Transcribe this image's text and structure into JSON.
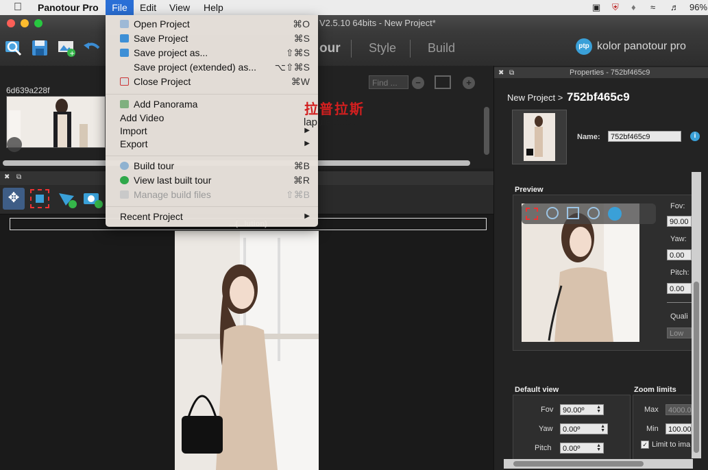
{
  "menubar": {
    "apple": "",
    "app_name": "Panotour Pro",
    "items": [
      "File",
      "Edit",
      "View",
      "Help"
    ],
    "battery": "96%"
  },
  "window": {
    "title": "V2.5.10 64bits - New Project*",
    "tabs": [
      "our",
      "Style",
      "Build"
    ],
    "brand": "kolor panotour pro",
    "brand_badge": "ptp"
  },
  "file_menu": {
    "items": [
      {
        "label": "Open Project",
        "shortcut": "⌘O",
        "icon": "open-icon"
      },
      {
        "label": "Save Project",
        "shortcut": "⌘S",
        "icon": "save-icon"
      },
      {
        "label": "Save project as...",
        "shortcut": "⇧⌘S",
        "icon": "save-as-icon"
      },
      {
        "label": "Save project (extended) as...",
        "shortcut": "⌥⇧⌘S",
        "icon": ""
      },
      {
        "label": "Close Project",
        "shortcut": "⌘W",
        "icon": "close-project-icon"
      },
      {
        "label": "Add Panorama",
        "shortcut": "",
        "icon": "add-panorama-icon"
      },
      {
        "label": "Add Video",
        "shortcut": "",
        "icon": ""
      },
      {
        "label": "Import",
        "shortcut": "",
        "icon": ""
      },
      {
        "label": "Export",
        "shortcut": "",
        "icon": ""
      },
      {
        "label": "Build tour",
        "shortcut": "⌘B",
        "icon": "build-icon"
      },
      {
        "label": "View last built tour",
        "shortcut": "⌘R",
        "icon": "play-icon"
      },
      {
        "label": "Manage build files",
        "shortcut": "⇧⌘B",
        "icon": "manage-icon"
      },
      {
        "label": "Recent Project",
        "shortcut": "",
        "icon": ""
      }
    ]
  },
  "watermark": {
    "cn": "拉普拉斯",
    "url": "lapulace.com"
  },
  "thumbs_panel": {
    "item_label": "6d639a228f",
    "find_placeholder": "Find ..."
  },
  "viewer": {
    "resolution_banner": "...(...lution)"
  },
  "properties": {
    "header": "Properties - 752bf465c9",
    "breadcrumb_root": "New Project >",
    "breadcrumb_leaf": "752bf465c9",
    "name_label": "Name:",
    "name_value": "752bf465c9",
    "preview_title": "Preview",
    "fov_label": "Fov:",
    "fov_value": "90.00",
    "yaw_label": "Yaw:",
    "yaw_value": "0.00",
    "pitch_label": "Pitch:",
    "pitch_value": "0.00",
    "quality_label": "Quali",
    "quality_value": "Low",
    "default_view_title": "Default view",
    "dv_fov_label": "Fov",
    "dv_fov_value": "90.00º",
    "dv_yaw_label": "Yaw",
    "dv_yaw_value": "0.00º",
    "dv_pitch_label": "Pitch",
    "dv_pitch_value": "0.00º",
    "zoom_title": "Zoom limits",
    "zoom_max_label": "Max",
    "zoom_max_value": "4000.0",
    "zoom_min_label": "Min",
    "zoom_min_value": "100.00",
    "limit_label": "Limit to ima"
  },
  "colors": {
    "accent": "#2a6fd6",
    "info": "#3aa0d8"
  }
}
